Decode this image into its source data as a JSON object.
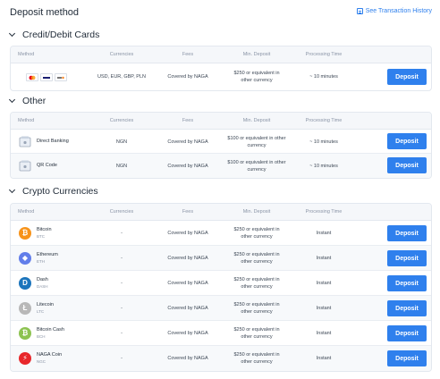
{
  "header": {
    "title": "Deposit method",
    "history_link": "See Transaction History"
  },
  "columns": [
    "Method",
    "Currencies",
    "Fees",
    "Min. Deposit",
    "Processing Time"
  ],
  "sections": {
    "cards": {
      "title": "Credit/Debit Cards",
      "row": {
        "card_icons": [
          "mastercard-icon",
          "visa-icon",
          "discover-icon"
        ],
        "currencies": "USD, EUR, GBP, PLN",
        "fees": "Covered by NAGA",
        "min_line1": "$250 or equivalent in",
        "min_line2": "other currency",
        "time": "~ 10 minutes",
        "button": "Deposit"
      }
    },
    "other": {
      "title": "Other",
      "rows": [
        {
          "name": "Direct Banking",
          "currencies": "NGN",
          "fees": "Covered by NAGA",
          "min_line1": "$100 or equivalent in other",
          "min_line2": "currency",
          "time": "~ 10 minutes",
          "button": "Deposit"
        },
        {
          "name": "QR Code",
          "currencies": "NGN",
          "fees": "Covered by NAGA",
          "min_line1": "$100 or equivalent in other",
          "min_line2": "currency",
          "time": "~ 10 minutes",
          "button": "Deposit"
        }
      ]
    },
    "crypto": {
      "title": "Crypto Currencies",
      "rows": [
        {
          "name": "Bitcoin",
          "ticker": "BTC",
          "currencies": "-",
          "fees": "Covered by NAGA",
          "min_line1": "$250 or equivalent in",
          "min_line2": "other currency",
          "time": "Instant",
          "button": "Deposit",
          "glyph": "₿",
          "color": "#f7931a"
        },
        {
          "name": "Ethereum",
          "ticker": "ETH",
          "currencies": "-",
          "fees": "Covered by NAGA",
          "min_line1": "$250 or equivalent in",
          "min_line2": "other currency",
          "time": "Instant",
          "button": "Deposit",
          "glyph": "◆",
          "color": "#627eea"
        },
        {
          "name": "Dash",
          "ticker": "DASH",
          "currencies": "-",
          "fees": "Covered by NAGA",
          "min_line1": "$250 or equivalent in",
          "min_line2": "other currency",
          "time": "Instant",
          "button": "Deposit",
          "glyph": "D",
          "color": "#1c75bc"
        },
        {
          "name": "Litecoin",
          "ticker": "LTC",
          "currencies": "-",
          "fees": "Covered by NAGA",
          "min_line1": "$250 or equivalent in",
          "min_line2": "other currency",
          "time": "Instant",
          "button": "Deposit",
          "glyph": "Ł",
          "color": "#b8b8b8"
        },
        {
          "name": "Bitcoin Cash",
          "ticker": "BCH",
          "currencies": "-",
          "fees": "Covered by NAGA",
          "min_line1": "$250 or equivalent in",
          "min_line2": "other currency",
          "time": "Instant",
          "button": "Deposit",
          "glyph": "₿",
          "color": "#8dc351"
        },
        {
          "name": "NAGA Coin",
          "ticker": "NGC",
          "currencies": "-",
          "fees": "Covered by NAGA",
          "min_line1": "$250 or equivalent in",
          "min_line2": "other currency",
          "time": "Instant",
          "button": "Deposit",
          "glyph": "⚡",
          "color": "#e8272b"
        }
      ]
    }
  },
  "colors": {
    "accent": "#2f80ed",
    "header_bg": "#f5f7fa",
    "border": "#e3e8ef"
  }
}
